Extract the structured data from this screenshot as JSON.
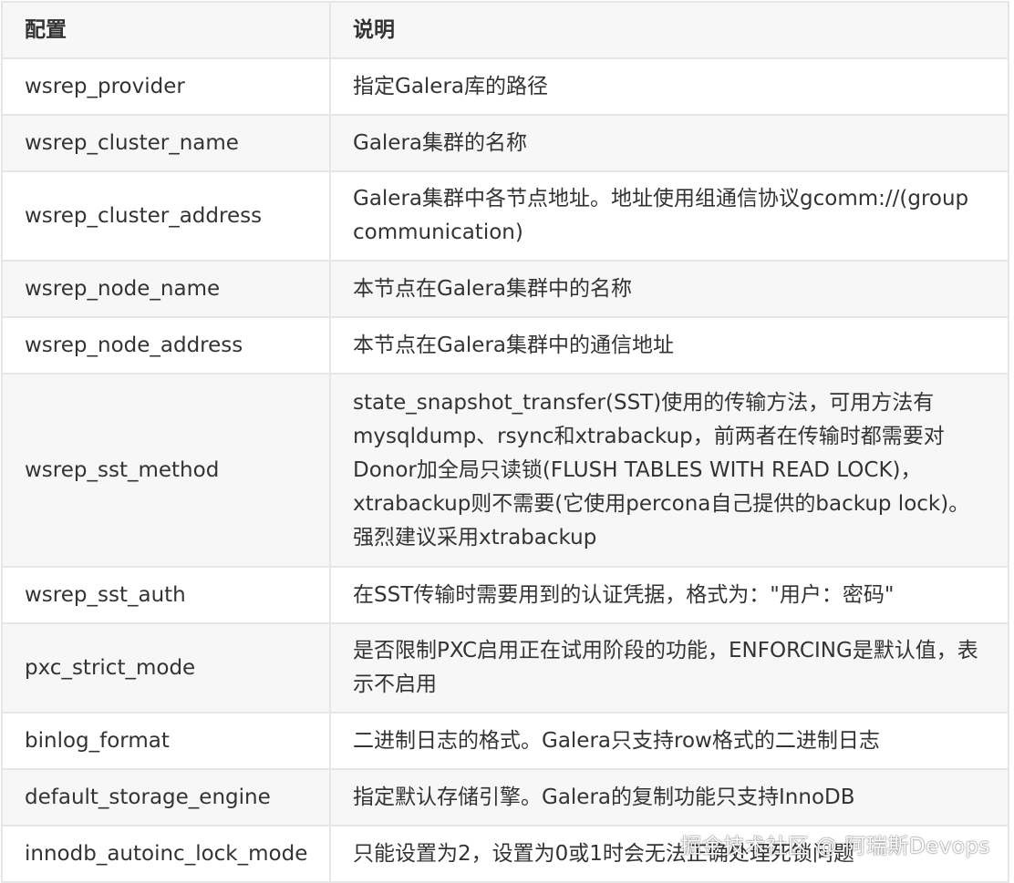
{
  "header": {
    "col1": "配置",
    "col2": "说明"
  },
  "rows": [
    {
      "key": "wsrep_provider",
      "desc": "指定Galera库的路径"
    },
    {
      "key": "wsrep_cluster_name",
      "desc": "Galera集群的名称"
    },
    {
      "key": "wsrep_cluster_address",
      "desc": "Galera集群中各节点地址。地址使用组通信协议gcomm://(group communication)"
    },
    {
      "key": "wsrep_node_name",
      "desc": "本节点在Galera集群中的名称"
    },
    {
      "key": "wsrep_node_address",
      "desc": "本节点在Galera集群中的通信地址"
    },
    {
      "key": "wsrep_sst_method",
      "desc": "state_snapshot_transfer(SST)使用的传输方法，可用方法有mysqldump、rsync和xtrabackup，前两者在传输时都需要对Donor加全局只读锁(FLUSH TABLES WITH READ LOCK)，xtrabackup则不需要(它使用percona自己提供的backup lock)。强烈建议采用xtrabackup"
    },
    {
      "key": "wsrep_sst_auth",
      "desc": "在SST传输时需要用到的认证凭据，格式为：\"用户：密码\""
    },
    {
      "key": "pxc_strict_mode",
      "desc": "是否限制PXC启用正在试用阶段的功能，ENFORCING是默认值，表示不启用"
    },
    {
      "key": "binlog_format",
      "desc": "二进制日志的格式。Galera只支持row格式的二进制日志"
    },
    {
      "key": "default_storage_engine",
      "desc": "指定默认存储引擎。Galera的复制功能只支持InnoDB"
    },
    {
      "key": "innodb_autoinc_lock_mode",
      "desc": "只能设置为2，设置为0或1时会无法正确处理死锁问题"
    }
  ],
  "watermark": "掘金技术社区 @ 阿瑞斯Devops"
}
